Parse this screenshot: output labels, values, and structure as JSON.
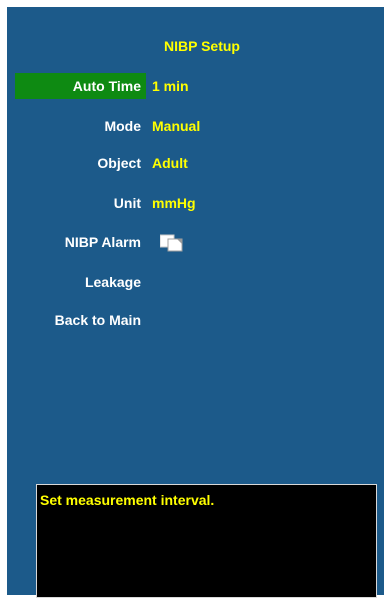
{
  "title": "NIBP Setup",
  "menu": [
    {
      "label": "Auto Time",
      "value": "1 min"
    },
    {
      "label": "Mode",
      "value": "Manual"
    },
    {
      "label": "Object",
      "value": "Adult"
    },
    {
      "label": "Unit",
      "value": "mmHg"
    },
    {
      "label": "NIBP Alarm",
      "icon": "alarm-settings-icon"
    },
    {
      "label": "Leakage"
    },
    {
      "label": "Back to Main"
    }
  ],
  "selected_item": "Auto Time",
  "help_text": "Set measurement interval.",
  "colors": {
    "background": "#1c5a8a",
    "highlight": "#0e8a12",
    "value_text": "#ffff00",
    "label_text": "#ffffff",
    "help_background": "#000000"
  }
}
